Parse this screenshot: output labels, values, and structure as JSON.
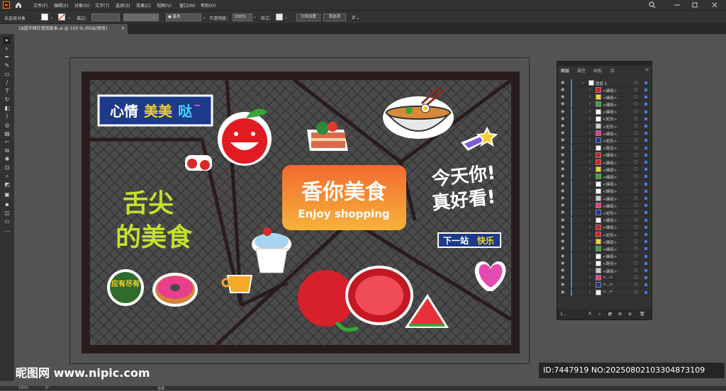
{
  "menubar": {
    "app_logo": "Ai",
    "home_icon": "home-icon",
    "items": [
      "文件(F)",
      "编辑(E)",
      "对象(O)",
      "文字(T)",
      "选择(S)",
      "效果(C)",
      "视图(V)",
      "窗口(W)",
      "帮助(H)"
    ],
    "window_controls": [
      "search-icon",
      "minimize-icon",
      "restore-icon",
      "close-icon"
    ]
  },
  "controlbar": {
    "selection_label": "未选择对象",
    "stroke_label": "描边：",
    "stroke_value": "",
    "brush_label": "● 基本",
    "opacity_label": "不透明度：",
    "opacity_value": "100%",
    "style_label": "样式：",
    "doc_setup_button": "文档设置",
    "prefs_button": "首选项"
  },
  "tab": {
    "title": "18超市网红墙恬版本.ai @ 100 % (RGB/预览)",
    "close": "×"
  },
  "design": {
    "sign_text_1": "心情",
    "sign_text_2": "美美",
    "sign_text_3": "哒",
    "sign_tilde": "~",
    "center_title": "香你美食",
    "center_subtitle": "Enjoy shopping",
    "right_slogan_1": "今天你!",
    "right_slogan_2": "真好看!",
    "next_stop_1": "下一站",
    "next_stop_2": "快乐",
    "left_slogan_1": "舌尖",
    "left_slogan_2": "的美食",
    "badge_text": "应有尽有",
    "accent_orange": "#f26a2e",
    "accent_yellow": "#f2d02b",
    "sign_blue": "#1e3a8a",
    "mesh_bg": "#4a4a4a",
    "frame_color": "#2a1c1c"
  },
  "layers_panel": {
    "tabs": [
      "图层",
      "属性",
      "画板",
      "库"
    ],
    "active_tab": "图层",
    "top_layer": "图层 1",
    "rows": [
      "<编组>",
      "<编组>",
      "<编组>",
      "<编组>",
      "<矩形>",
      "<矩形>",
      "<编组>",
      "<矩形>",
      "<路径>",
      "<编组>",
      "<编组>",
      "<编组>",
      "<编组>",
      "<编组>",
      "<编组>",
      "<编组>",
      "<编组>",
      "<矩形>",
      "<编组>",
      "<编组>",
      "<矩形>",
      "<编组>",
      "<编组>",
      "<编组>",
      "<路径>",
      "<编组>",
      "<...>",
      "<...>",
      "<...>"
    ],
    "footer_count": "1..."
  },
  "statusbar": {
    "zoom": "100%",
    "angle": "0°",
    "tool": "选择"
  },
  "watermark": {
    "site": "昵图网 www.nipic.com",
    "id_text": "ID:7447919 NO:20250802103304873109"
  }
}
